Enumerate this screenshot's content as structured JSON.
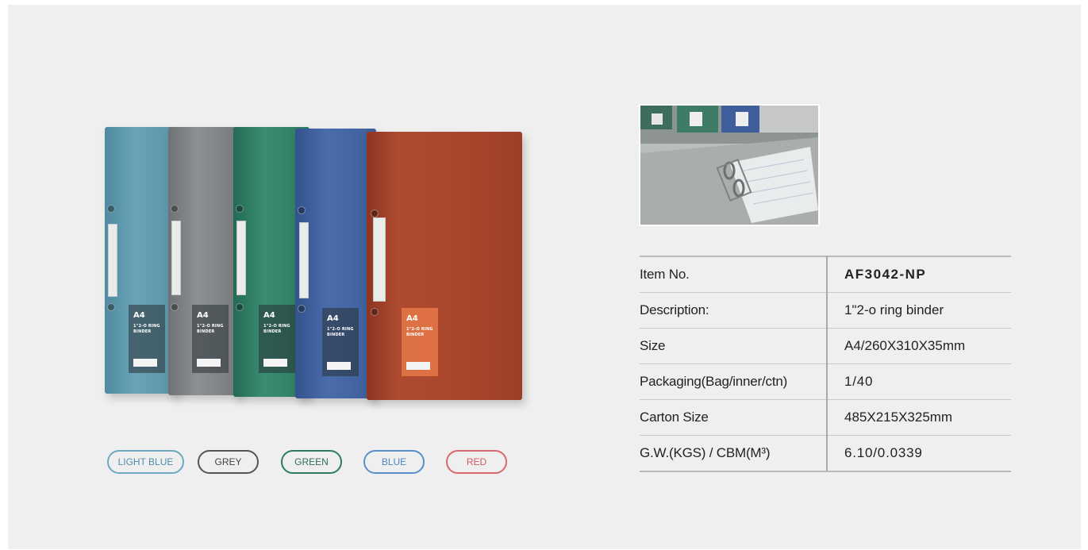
{
  "binder_sticker": {
    "size": "A4",
    "subtitle": "1\"2-O RING BINDER"
  },
  "colors": [
    {
      "label": "LIGHT BLUE",
      "border": "#6fa8c2",
      "text": "#4f8fb0",
      "body": "#5b93a6"
    },
    {
      "label": "GREY",
      "border": "#555555",
      "text": "#444444",
      "body": "#7c7f80"
    },
    {
      "label": "GREEN",
      "border": "#2d7a62",
      "text": "#2d6f58",
      "body": "#2f7e66"
    },
    {
      "label": "BLUE",
      "border": "#5a8fce",
      "text": "#4f86c6",
      "body": "#3e5f9a"
    },
    {
      "label": "RED",
      "border": "#d9686a",
      "text": "#d25a5c",
      "body": "#a9462d"
    }
  ],
  "spec": {
    "rows": [
      {
        "key": "Item No.",
        "value": "AF3042-NP"
      },
      {
        "key": "Description:",
        "value": "1\"2-o ring binder"
      },
      {
        "key": "Size",
        "value": "A4/260X310X35mm"
      },
      {
        "key": "Packaging(Bag/inner/ctn)",
        "value": "1/40"
      },
      {
        "key": "Carton Size",
        "value": "485X215X325mm"
      },
      {
        "key": "G.W.(KGS) / CBM(M³)",
        "value": "6.10/0.0339"
      }
    ]
  }
}
